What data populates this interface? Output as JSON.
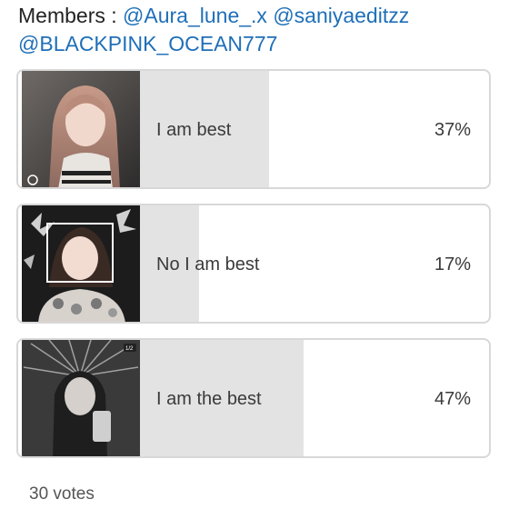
{
  "header": {
    "prefix": "Members : ",
    "mention_1": "@Aura_lune_.x",
    "mention_2": "@saniyaeditzz",
    "mention_3": "@BLACKPINK_OCEAN777"
  },
  "poll": {
    "options": [
      {
        "label": "I am best",
        "percent_text": "37%",
        "percent_value": 37
      },
      {
        "label": "No I am best",
        "percent_text": "17%",
        "percent_value": 17
      },
      {
        "label": "I am the best",
        "percent_text": "47%",
        "percent_value": 47
      }
    ],
    "votes_text": "30 votes"
  },
  "colors": {
    "mention": "#1f6fb8",
    "bar_fill": "#e3e3e3",
    "border": "#d8d8d8"
  }
}
